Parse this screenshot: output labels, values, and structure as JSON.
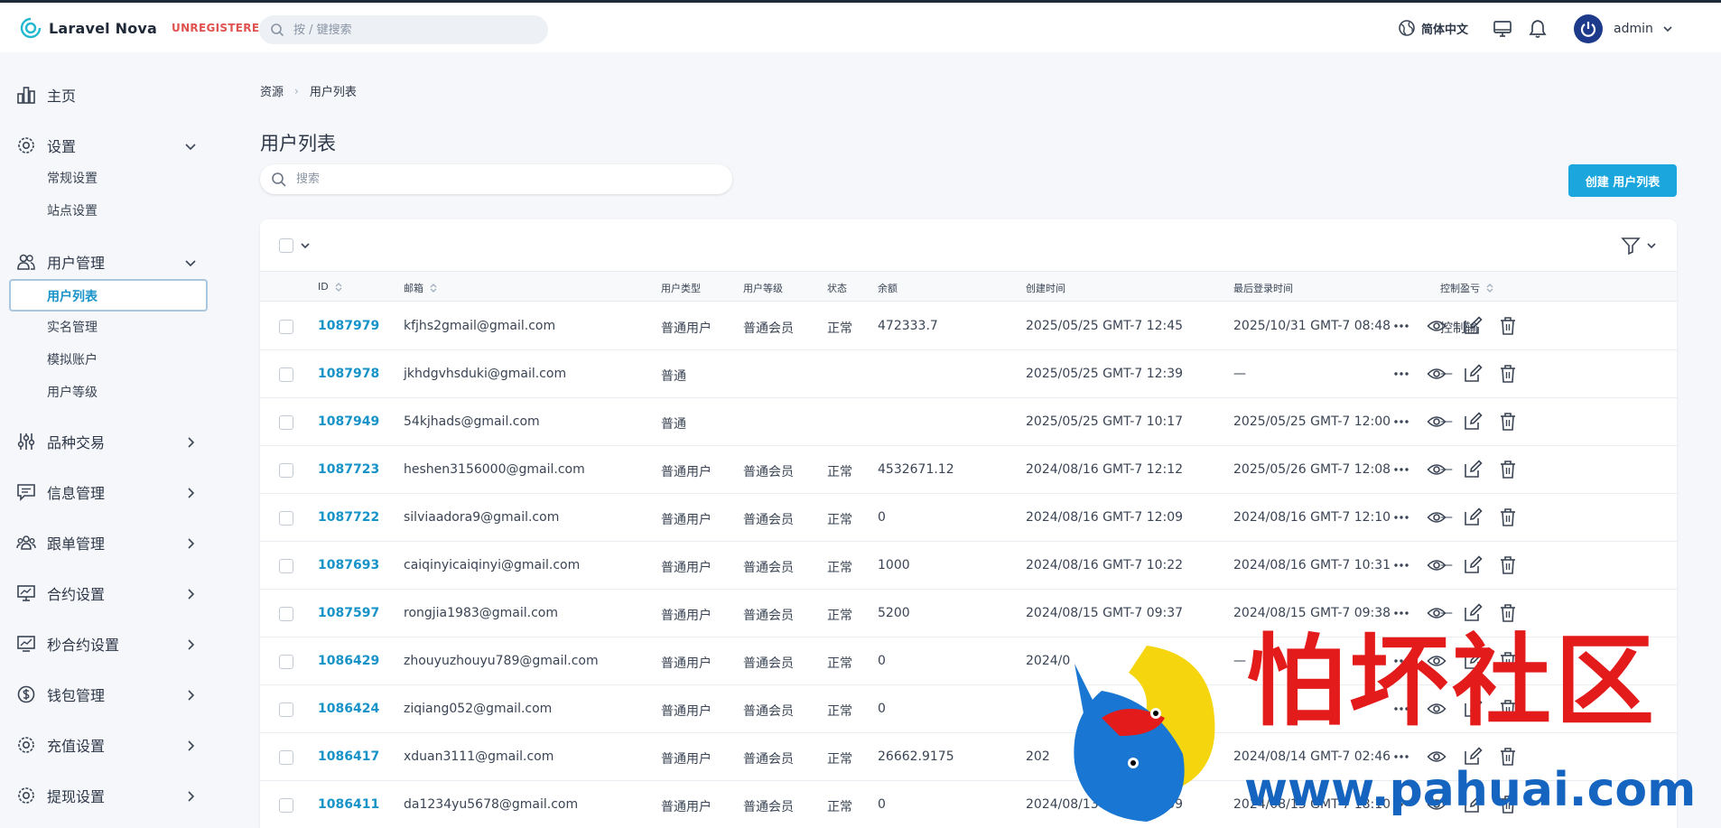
{
  "app": {
    "name": "Laravel Nova",
    "badge": "UNREGISTERED",
    "search_placeholder": "按 / 键搜索",
    "language": "简体中文",
    "username": "admin"
  },
  "sidebar": {
    "home": "主页",
    "settings": {
      "label": "设置",
      "items": [
        "常规设置",
        "站点设置"
      ]
    },
    "users": {
      "label": "用户管理",
      "items": [
        "用户列表",
        "实名管理",
        "模拟账户",
        "用户等级"
      ],
      "active": "用户列表"
    },
    "sections": [
      "品种交易",
      "信息管理",
      "跟单管理",
      "合约设置",
      "秒合约设置",
      "钱包管理",
      "充值设置",
      "提现设置"
    ]
  },
  "breadcrumb": [
    "资源",
    "用户列表"
  ],
  "page": {
    "title": "用户列表",
    "search_placeholder": "搜索",
    "create_button": "创建 用户列表"
  },
  "table": {
    "columns": [
      "ID",
      "邮箱",
      "用户类型",
      "用户等级",
      "状态",
      "余额",
      "创建时间",
      "最后登录时间",
      "控制盈亏"
    ],
    "rows": [
      {
        "id": "1087979",
        "email": "kfjhs2gmail@gmail.com",
        "type": "普通用户",
        "level": "普通会员",
        "status": "正常",
        "balance": "472333.7",
        "created": "2025/05/25 GMT-7 12:45",
        "last_login": "2025/10/31 GMT-7 08:48",
        "control": "控制输"
      },
      {
        "id": "1087978",
        "email": "jkhdgvhsduki@gmail.com",
        "type": "普通",
        "level": "",
        "status": "",
        "balance": "",
        "created": "2025/05/25 GMT-7 12:39",
        "last_login": "—",
        "control": "—"
      },
      {
        "id": "1087949",
        "email": "54kjhads@gmail.com",
        "type": "普通",
        "level": "",
        "status": "",
        "balance": "",
        "created": "2025/05/25 GMT-7 10:17",
        "last_login": "2025/05/25 GMT-7 12:00",
        "control": "—"
      },
      {
        "id": "1087723",
        "email": "heshen3156000@gmail.com",
        "type": "普通用户",
        "level": "普通会员",
        "status": "正常",
        "balance": "4532671.12",
        "created": "2024/08/16 GMT-7 12:12",
        "last_login": "2025/05/26 GMT-7 12:08",
        "control": "—"
      },
      {
        "id": "1087722",
        "email": "silviaadora9@gmail.com",
        "type": "普通用户",
        "level": "普通会员",
        "status": "正常",
        "balance": "0",
        "created": "2024/08/16 GMT-7 12:09",
        "last_login": "2024/08/16 GMT-7 12:10",
        "control": "—"
      },
      {
        "id": "1087693",
        "email": "caiqinyicaiqinyi@gmail.com",
        "type": "普通用户",
        "level": "普通会员",
        "status": "正常",
        "balance": "1000",
        "created": "2024/08/16 GMT-7 10:22",
        "last_login": "2024/08/16 GMT-7 10:31",
        "control": "—"
      },
      {
        "id": "1087597",
        "email": "rongjia1983@gmail.com",
        "type": "普通用户",
        "level": "普通会员",
        "status": "正常",
        "balance": "5200",
        "created": "2024/08/15 GMT-7 09:37",
        "last_login": "2024/08/15 GMT-7 09:38",
        "control": "—"
      },
      {
        "id": "1086429",
        "email": "zhouyuzhouyu789@gmail.com",
        "type": "普通用户",
        "level": "普通会员",
        "status": "正常",
        "balance": "0",
        "created": "2024/0",
        "last_login": "—",
        "control": ""
      },
      {
        "id": "1086424",
        "email": "ziqiang052@gmail.com",
        "type": "普通用户",
        "level": "普通会员",
        "status": "正常",
        "balance": "0",
        "created": "",
        "last_login": "",
        "control": ""
      },
      {
        "id": "1086417",
        "email": "xduan3111@gmail.com",
        "type": "普通用户",
        "level": "普通会员",
        "status": "正常",
        "balance": "26662.9175",
        "created": "202",
        "last_login": "2024/08/14 GMT-7 02:46",
        "control": ""
      },
      {
        "id": "1086411",
        "email": "da1234yu5678@gmail.com",
        "type": "普通用户",
        "level": "普通会员",
        "status": "正常",
        "balance": "0",
        "created": "2024/08/13 GMT-7 18:09",
        "last_login": "2024/08/13 GMT-7 18:10",
        "control": ""
      }
    ]
  },
  "watermark": {
    "title": "怕坏社区",
    "url": "www.pahuai.com"
  },
  "colors": {
    "accent": "#1ba6dd",
    "link": "#1793c8",
    "badge": "#e0524f",
    "watermark_red": "#e31b1b",
    "watermark_blue": "#1565c0"
  }
}
